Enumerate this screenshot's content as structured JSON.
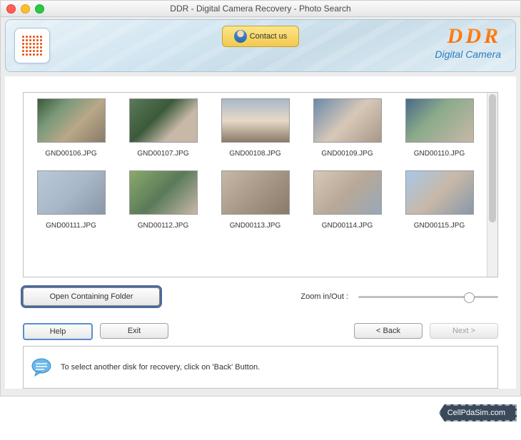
{
  "window": {
    "title": "DDR - Digital Camera Recovery - Photo Search"
  },
  "header": {
    "contact": "Contact us",
    "brand": "DDR",
    "brandSub": "Digital Camera"
  },
  "files": [
    {
      "name": "GND00106.JPG"
    },
    {
      "name": "GND00107.JPG"
    },
    {
      "name": "GND00108.JPG"
    },
    {
      "name": "GND00109.JPG"
    },
    {
      "name": "GND00110.JPG"
    },
    {
      "name": "GND00111.JPG"
    },
    {
      "name": "GND00112.JPG"
    },
    {
      "name": "GND00113.JPG"
    },
    {
      "name": "GND00114.JPG"
    },
    {
      "name": "GND00115.JPG"
    }
  ],
  "mid": {
    "openFolder": "Open Containing Folder",
    "zoomLabel": "Zoom in/Out :"
  },
  "nav": {
    "help": "Help",
    "exit": "Exit",
    "back": "< Back",
    "next": "Next >"
  },
  "hint": {
    "text": "To select another disk for recovery, click on 'Back' Button."
  },
  "watermark": "CellPdaSim.com"
}
